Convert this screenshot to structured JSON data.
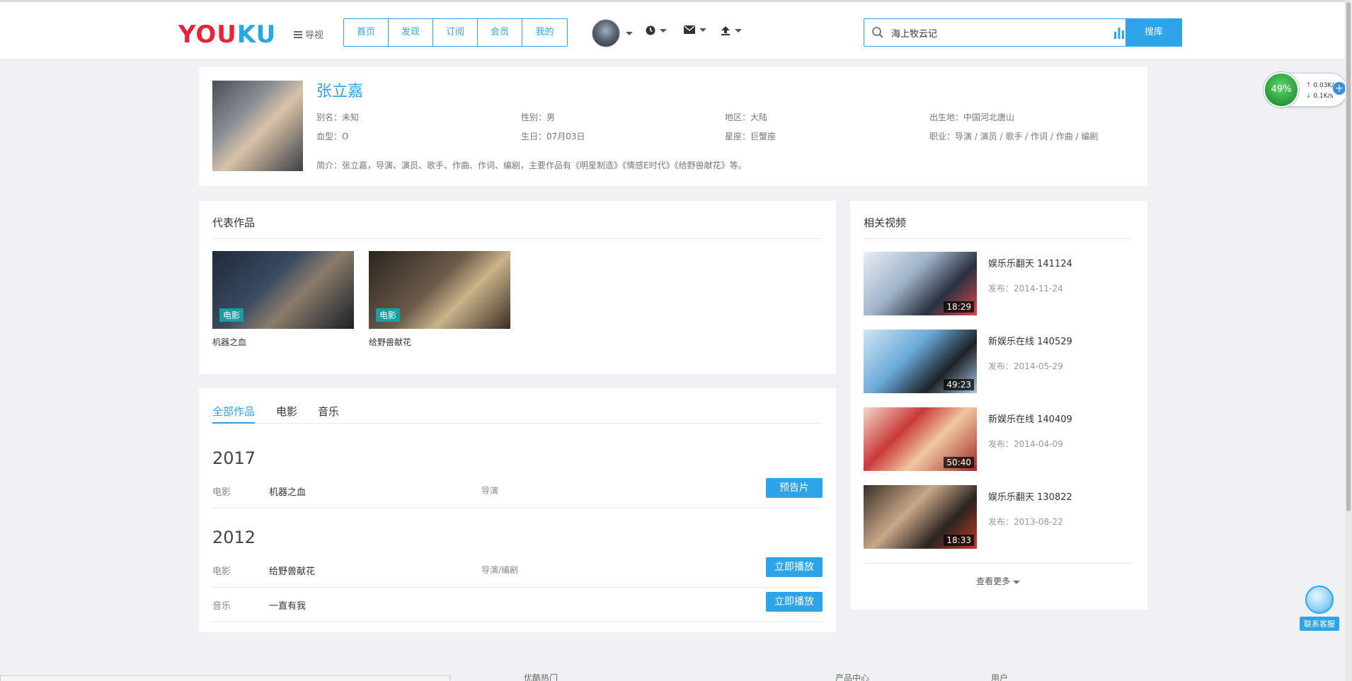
{
  "header": {
    "logo": {
      "part1": "YOU",
      "part2": "KU"
    },
    "guide_label": "导视",
    "nav": [
      "首页",
      "发现",
      "订阅",
      "会员",
      "我的"
    ],
    "search": {
      "value": "海上牧云记",
      "button": "搜库"
    }
  },
  "profile": {
    "name": "张立嘉",
    "alias": "别名：未知",
    "gender": "性别：男",
    "region": "地区：大陆",
    "birthplace": "出生地：中国河北唐山",
    "blood": "血型：O",
    "birthday": "生日：07月03日",
    "constellation": "星座：巨蟹座",
    "profession": "职业：导演 / 演员 / 歌手 / 作词 / 作曲 / 编剧",
    "intro": "简介：张立嘉，导演、演员、歌手、作曲、作词、编剧，主要作品有《明星制造》《情感E时代》《给野兽献花》等。"
  },
  "works": {
    "title": "代表作品",
    "items": [
      {
        "tag": "电影",
        "label": "机器之血"
      },
      {
        "tag": "电影",
        "label": "给野兽献花"
      }
    ]
  },
  "films": {
    "tabs": [
      "全部作品",
      "电影",
      "音乐"
    ],
    "groups": [
      {
        "year": "2017",
        "rows": [
          {
            "type": "电影",
            "title": "机器之血",
            "role": "导演",
            "action": "预告片"
          }
        ]
      },
      {
        "year": "2012",
        "rows": [
          {
            "type": "电影",
            "title": "给野兽献花",
            "role": "导演/编剧",
            "action": "立即播放"
          },
          {
            "type": "音乐",
            "title": "一直有我",
            "role": "",
            "action": "立即播放"
          }
        ]
      }
    ]
  },
  "related": {
    "title": "相关视频",
    "items": [
      {
        "title": "娱乐乐翻天 141124",
        "date": "发布：2014-11-24",
        "duration": "18:29"
      },
      {
        "title": "新娱乐在线 140529",
        "date": "发布：2014-05-29",
        "duration": "49:23"
      },
      {
        "title": "新娱乐在线 140409",
        "date": "发布：2014-04-09",
        "duration": "50:40"
      },
      {
        "title": "娱乐乐翻天 130822",
        "date": "发布：2013-08-22",
        "duration": "18:33"
      }
    ],
    "more": "查看更多"
  },
  "widgets": {
    "speed_percent": "49%",
    "up_rate": "0.03K/s",
    "down_rate": "0.1K/s",
    "service_label": "联系客服"
  },
  "footer": [
    "优酷热门",
    "产品中心",
    "用户"
  ]
}
